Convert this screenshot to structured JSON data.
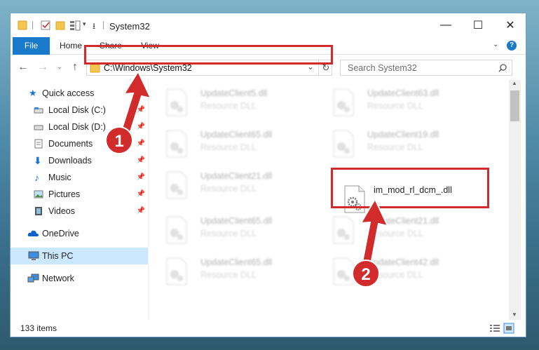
{
  "window": {
    "title": "System32",
    "minimize": "—",
    "maximize": "☐",
    "close": "✕"
  },
  "ribbon": {
    "tabs": [
      "File",
      "Home",
      "Share",
      "View"
    ],
    "help": "?"
  },
  "address": {
    "path": "C:\\Windows\\System32",
    "search_placeholder": "Search System32"
  },
  "sidebar": {
    "items": [
      {
        "label": "Quick access",
        "icon": "star-icon"
      },
      {
        "label": "Local Disk (C:)",
        "icon": "drive-icon"
      },
      {
        "label": "Local Disk (D:)",
        "icon": "drive-icon"
      },
      {
        "label": "Documents",
        "icon": "documents-icon"
      },
      {
        "label": "Downloads",
        "icon": "download-icon"
      },
      {
        "label": "Music",
        "icon": "music-icon"
      },
      {
        "label": "Pictures",
        "icon": "pictures-icon"
      },
      {
        "label": "Videos",
        "icon": "videos-icon"
      },
      {
        "label": "OneDrive",
        "icon": "cloud-icon"
      },
      {
        "label": "This PC",
        "icon": "computer-icon"
      },
      {
        "label": "Network",
        "icon": "network-icon"
      }
    ]
  },
  "files": [
    {
      "name": "UpdateClient5.dll",
      "desc": "Resource DLL"
    },
    {
      "name": "UpdateClient63.dll",
      "desc": "Resource DLL"
    },
    {
      "name": "UpdateClient65.dll",
      "desc": "Resource DLL"
    },
    {
      "name": "UpdateClient19.dll",
      "desc": "Resource DLL"
    },
    {
      "name": "UpdateClient21.dll",
      "desc": "Resource DLL"
    },
    {
      "name": "im_mod_rl_dcm_.dll",
      "desc": ""
    },
    {
      "name": "UpdateClient65.dll",
      "desc": "Resource DLL"
    },
    {
      "name": "UpdateClient21.dll",
      "desc": "Resource DLL"
    },
    {
      "name": "UpdateClient65.dll",
      "desc": "Resource DLL"
    },
    {
      "name": "UpdateClient42.dll",
      "desc": "Resource DLL"
    }
  ],
  "status": {
    "count": "133 items"
  },
  "callouts": [
    "1",
    "2"
  ],
  "colors": {
    "accent": "#1979ca",
    "highlight": "#d22b2b",
    "selected": "#cce8ff"
  }
}
